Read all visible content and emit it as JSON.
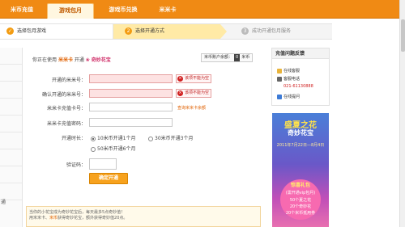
{
  "nav": {
    "tabs": [
      {
        "label": "米币充值"
      },
      {
        "label": "游戏包月"
      },
      {
        "label": "游戏币兑换"
      },
      {
        "label": "米米卡"
      }
    ],
    "active_index": 1,
    "accent": "#f08a14"
  },
  "steps": [
    {
      "num": "✓",
      "label": "选择包月游戏"
    },
    {
      "num": "2",
      "label": "选择开通方式"
    },
    {
      "num": "3",
      "label": "成功开通包月服务"
    }
  ],
  "left_sidebar": {
    "label": "通"
  },
  "form": {
    "using_prefix": "你正在使用",
    "using_brand": "米米卡",
    "using_action": "开通",
    "using_product": "奇妙花宝",
    "balance_label": "米币账户余额：",
    "balance_value": "0",
    "balance_unit": "米币",
    "fields": [
      {
        "label": "开通的米米号：",
        "error": "该项不能为空",
        "hint": ""
      },
      {
        "label": "确认开通的米米号：",
        "error": "该项不能为空",
        "hint": ""
      },
      {
        "label": "米米卡充值卡号：",
        "error": "",
        "hint": "查询米米卡余额"
      },
      {
        "label": "米米卡充值密码：",
        "error": "",
        "hint": ""
      }
    ],
    "duration_label": "开通时长：",
    "duration_options": [
      {
        "label": "10米币开通1个月",
        "checked": true
      },
      {
        "label": "30米币开通3个月",
        "checked": false
      },
      {
        "label": "50米币开通6个月",
        "checked": false
      }
    ],
    "captcha_label": "验证码：",
    "submit_label": "确定开通"
  },
  "notice": {
    "line1": "当你的小花宝成为奇妙花宝后，每天最多5点奇妙值！",
    "line2_prefix": "用米米卡、",
    "line2_hl": "米币",
    "line2_suffix": "获得奇妙花宝，额外获得奇妙值20点。"
  },
  "help": {
    "title": "充值问题反馈",
    "items": [
      {
        "label": "在线客服",
        "icon": "chat-icon"
      },
      {
        "label": "客服电话",
        "icon": "phone-icon"
      },
      {
        "label": "021-61130888",
        "icon": ""
      },
      {
        "label": "在线提问",
        "icon": "question-icon"
      }
    ]
  },
  "banner": {
    "title": "盛夏之花",
    "subtitle": "奇妙花宝",
    "date": "2011年7月22日—8月4日",
    "gift_title": "惊喜礼包",
    "gift_sub": "(需开通vip包月)",
    "gift_items": [
      "50个夏之花",
      "20个奇妙花",
      "20个米币抵用券"
    ]
  }
}
